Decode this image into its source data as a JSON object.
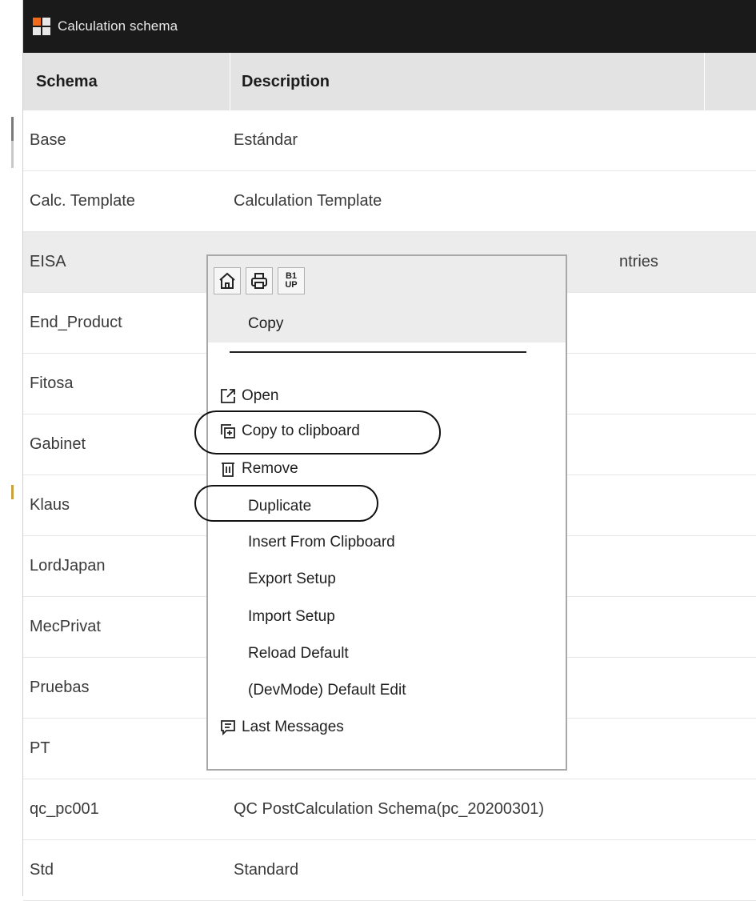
{
  "window": {
    "title": "Calculation schema"
  },
  "table": {
    "columns": [
      "Schema",
      "Description",
      ""
    ],
    "rows": [
      {
        "schema": "Base",
        "description": "Estándar"
      },
      {
        "schema": "Calc. Template",
        "description": "Calculation Template"
      },
      {
        "schema": "EISA",
        "description": "ntries"
      },
      {
        "schema": "End_Product",
        "description": ""
      },
      {
        "schema": "Fitosa",
        "description": ""
      },
      {
        "schema": "Gabinet",
        "description": ""
      },
      {
        "schema": "Klaus",
        "description": ""
      },
      {
        "schema": "LordJapan",
        "description": ""
      },
      {
        "schema": "MecPrivat",
        "description": ""
      },
      {
        "schema": "Pruebas",
        "description": ""
      },
      {
        "schema": "PT",
        "description": ""
      },
      {
        "schema": "qc_pc001",
        "description": "QC PostCalculation Schema(pc_20200301)"
      },
      {
        "schema": "Std",
        "description": "Standard"
      }
    ],
    "selected_row": "EISA"
  },
  "context_menu": {
    "toolbar": [
      {
        "icon": "home-icon"
      },
      {
        "icon": "print-icon"
      },
      {
        "icon": "b1up-icon",
        "text_top": "B1",
        "text_bottom": "UP"
      }
    ],
    "header_item": "Copy",
    "items": [
      {
        "label": "Open",
        "icon": "open-external-icon"
      },
      {
        "label": "Copy to clipboard",
        "icon": "copy-clipboard-icon",
        "highlighted": true
      },
      {
        "label": "Remove",
        "icon": "trash-icon"
      },
      {
        "label": "Duplicate",
        "icon": "",
        "highlighted": true
      },
      {
        "label": "Insert From Clipboard",
        "icon": ""
      },
      {
        "label": "Export Setup",
        "icon": ""
      },
      {
        "label": "Import Setup",
        "icon": ""
      },
      {
        "label": "Reload Default",
        "icon": ""
      },
      {
        "label": "(DevMode) Default Edit",
        "icon": ""
      },
      {
        "label": "Last Messages",
        "icon": "message-icon"
      }
    ]
  },
  "colors": {
    "titlebar": "#1a1a1a",
    "header_bg": "#e3e3e3",
    "selected_row": "#ececec",
    "logo_orange": "#f26b1d"
  }
}
